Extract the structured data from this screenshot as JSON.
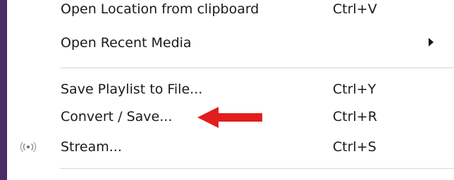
{
  "menu": {
    "items": [
      {
        "label": "Open Location from clipboard",
        "shortcut": "Ctrl+V"
      },
      {
        "label": "Open Recent Media",
        "submenu_icon": "chevron-right-icon"
      },
      {
        "label": "Save Playlist to File...",
        "shortcut": "Ctrl+Y"
      },
      {
        "label": "Convert / Save...",
        "shortcut": "Ctrl+R"
      },
      {
        "label": "Stream...",
        "shortcut": "Ctrl+S",
        "icon": "stream-icon"
      }
    ]
  },
  "annotation": {
    "icon": "red-arrow-left",
    "color": "#e11d1d"
  },
  "colors": {
    "left_border": "#4b2e63",
    "separator": "#d6d6d6"
  }
}
